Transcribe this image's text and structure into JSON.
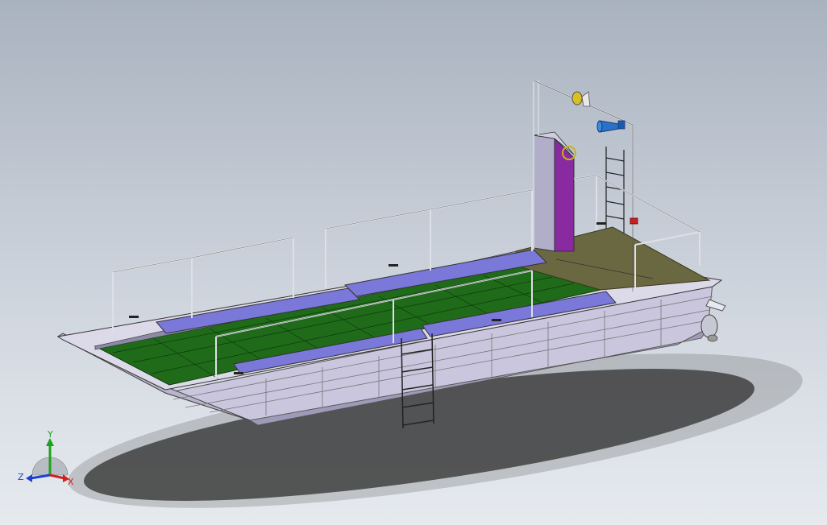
{
  "viewport": {
    "background_top": "#a9b2bf",
    "background_bottom": "#e6eaef"
  },
  "model": {
    "hull_color": "#c9c6dc",
    "deck_color": "#1f6b1a",
    "aft_deck_color": "#6a6840",
    "bench_color": "#7a78d8",
    "console_color": "#8a2aa0",
    "rail_color": "#cfd3da",
    "horn_color": "#2a72c8",
    "light_color": "#d8c020",
    "extinguisher_color": "#cc2020"
  },
  "triad": {
    "x_label": "X",
    "y_label": "Y",
    "z_label": "Z",
    "x_color": "#d02020",
    "y_color": "#20a020",
    "z_color": "#2040d0"
  }
}
